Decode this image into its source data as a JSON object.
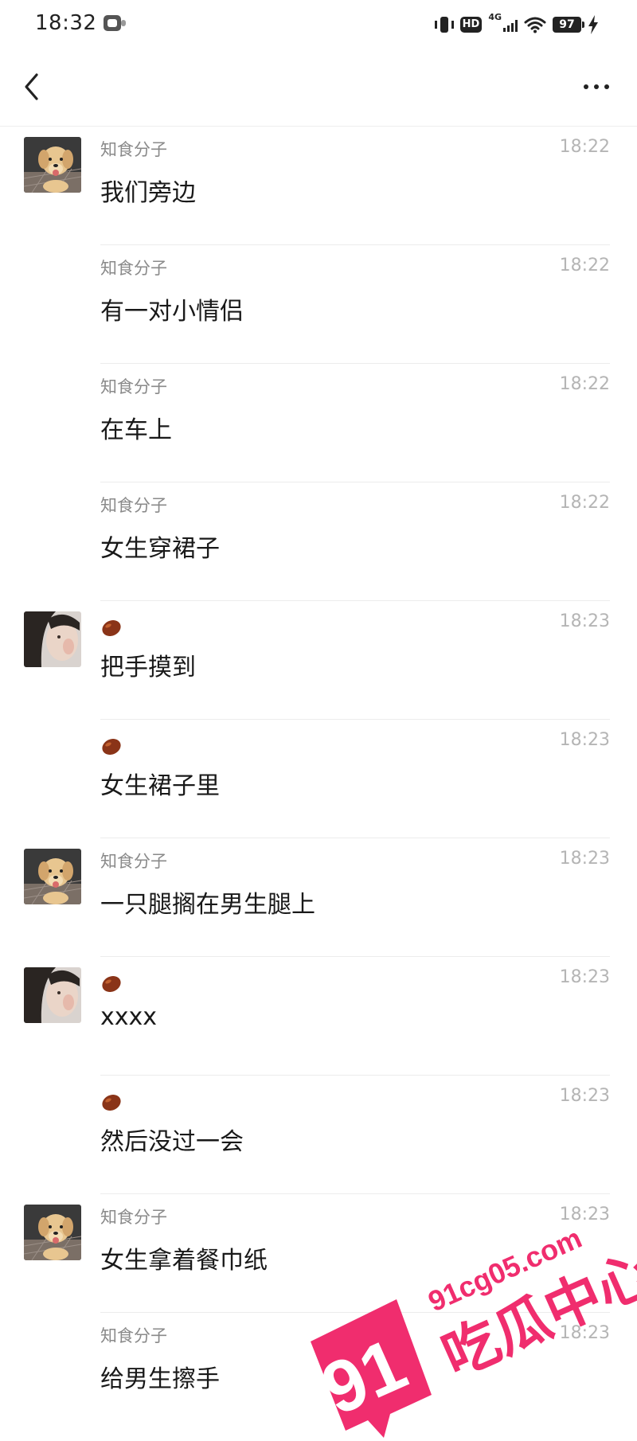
{
  "status_bar": {
    "time": "18:32",
    "network_label": "4G",
    "hd_label": "HD",
    "battery_level": "97",
    "icons": [
      "app-notification-icon",
      "vibrate-icon",
      "hd-icon",
      "signal-icon",
      "wifi-icon",
      "battery-icon",
      "charging-icon"
    ]
  },
  "nav": {
    "back_icon": "chevron-left-icon",
    "more_icon": "more-dots-icon"
  },
  "messages": [
    {
      "avatar": "puppy",
      "sender": "知食分子",
      "time": "18:22",
      "text": "我们旁边"
    },
    {
      "avatar": "",
      "sender": "知食分子",
      "time": "18:22",
      "text": "有一对小情侣"
    },
    {
      "avatar": "",
      "sender": "知食分子",
      "time": "18:22",
      "text": "在车上"
    },
    {
      "avatar": "",
      "sender": "知食分子",
      "time": "18:22",
      "text": "女生穿裙子"
    },
    {
      "avatar": "girl",
      "sender": "",
      "sender_icon": "red-bean-emoji",
      "time": "18:23",
      "text": "把手摸到"
    },
    {
      "avatar": "",
      "sender": "",
      "sender_icon": "red-bean-emoji",
      "time": "18:23",
      "text": "女生裙子里"
    },
    {
      "avatar": "puppy",
      "sender": "知食分子",
      "time": "18:23",
      "text": "一只腿搁在男生腿上"
    },
    {
      "avatar": "girl",
      "sender": "",
      "sender_icon": "red-bean-emoji",
      "time": "18:23",
      "text": "xxxx"
    },
    {
      "avatar": "",
      "sender": "",
      "sender_icon": "red-bean-emoji",
      "time": "18:23",
      "text": "然后没过一会"
    },
    {
      "avatar": "puppy",
      "sender": "知食分子",
      "time": "18:23",
      "text": "女生拿着餐巾纸"
    },
    {
      "avatar": "",
      "sender": "知食分子",
      "time": "18:23",
      "text": "给男生擦手"
    }
  ],
  "watermark": {
    "number": "91",
    "domain": "91cg05.com",
    "site_name": "吃瓜中心",
    "color": "#f02d6e"
  },
  "colors": {
    "sender": "#8a8a8a",
    "time": "#b5b5b5",
    "divider": "#ececec",
    "background": "#ffffff"
  }
}
